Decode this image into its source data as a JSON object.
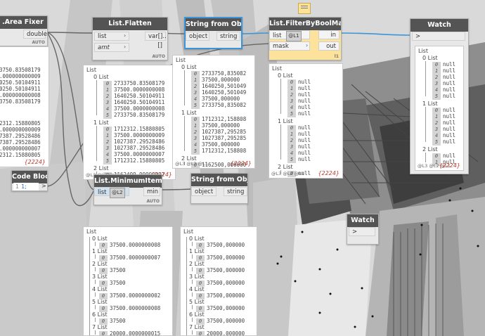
{
  "nodes": {
    "area_fixer": {
      "title": ".Area Fixer",
      "output": "double",
      "lacing": "AUTO"
    },
    "flatten": {
      "title": "List.Flatten",
      "inputs": [
        "list",
        "amt"
      ],
      "output": "var[]..[]",
      "lacing": "AUTO"
    },
    "string_obj_1": {
      "title": "String from Object",
      "input": "object",
      "output": "string"
    },
    "filter": {
      "title": "List.FilterByBoolMask",
      "inputs": [
        "list",
        "mask"
      ],
      "outputs": [
        "in",
        "out"
      ],
      "lacing": "l1",
      "level_selector": "@L1"
    },
    "watch_1": {
      "title": "Watch",
      "input": ">"
    },
    "code_block": {
      "title": "Code Block",
      "line_no": "1",
      "code": "1;",
      "output": ">"
    },
    "minimum": {
      "title": "List.MinimumItem",
      "input": "list",
      "output": "min",
      "lacing": "AUTO",
      "level_selector": "@L2"
    },
    "string_obj_2": {
      "title": "String from Object",
      "input": "object",
      "output": "string"
    },
    "watch_2": {
      "title": "Watch",
      "input": ">"
    }
  },
  "previews": {
    "area_fixer": {
      "rows": [
        "3750.83508179",
        ".000000000009",
        "0250.50104911",
        "0250.50104911",
        ".000000000008",
        "3750.83508179",
        "2312.15880805",
        ".000000000009",
        "7387.29528486",
        "7387.29528486",
        ".000000000007",
        "2312.15880805"
      ],
      "count": "{2224}"
    },
    "flatten": {
      "title": "List",
      "sub0": "0 List",
      "sub0_rows": [
        "2733750.83508179",
        "37500.0000000008",
        "1640250.50104911",
        "1640250.50104911",
        "37500.0000000008",
        "2733750.83508179"
      ],
      "sub1": "1 List",
      "sub1_rows": [
        "1712312.15880805",
        "37500.0000000009",
        "1027387.29528486",
        "1027387.29528486",
        "37500.0000000007",
        "1712312.15880805"
      ],
      "sub2": "2 List",
      "sub2_rows": [
        "1162499.99999997"
      ],
      "levels": "@L3 @L2 @L1",
      "count": "{2224}"
    },
    "string_obj_1": {
      "title": "List",
      "sub0": "0 List",
      "sub0_rows": [
        "2733750,835082",
        "37500,000000",
        "1640250,501049",
        "1640250,501049",
        "37500,000000",
        "2733750,835082"
      ],
      "sub1": "1 List",
      "sub1_rows": [
        "1712312,158808",
        "37500,000000",
        "1027387,295285",
        "1027387,295285",
        "37500,000000",
        "1712312,158808"
      ],
      "sub2": "2 List",
      "sub2_rows": [
        "1162500,000000"
      ],
      "levels": "@L3 @L2 @L1",
      "count": "{2224}"
    },
    "filter": {
      "title": "List",
      "sub0": "0 List",
      "sub0_rows": [
        "null",
        "null",
        "null",
        "null",
        "null",
        "null"
      ],
      "sub1": "1 List",
      "sub1_rows": [
        "null",
        "null",
        "null",
        "null",
        "null",
        "null"
      ],
      "sub2": "2 List",
      "sub2_rows": [
        "null"
      ],
      "levels": "@L3 @L2 @L1",
      "count": "{2224}"
    },
    "watch_1": {
      "title": "List",
      "sub0": "0 List",
      "sub0_rows": [
        "null",
        "null",
        "null",
        "null",
        "null",
        "null"
      ],
      "sub1": "1 List",
      "sub1_rows": [
        "null",
        "null",
        "null",
        "null",
        "null",
        "null"
      ],
      "sub2": "2 List",
      "sub2_rows": [
        "null",
        "null"
      ],
      "levels": "@L3 @L2 @L1",
      "count": "{2224}"
    },
    "minimum": {
      "title": "List",
      "items": [
        {
          "label": "0 List",
          "value": "37500.0000000008"
        },
        {
          "label": "1 List",
          "value": "37500.0000000007"
        },
        {
          "label": "2 List",
          "value": "37500"
        },
        {
          "label": "3 List",
          "value": "37500"
        },
        {
          "label": "4 List",
          "value": "37500.0000000002"
        },
        {
          "label": "5 List",
          "value": "37500.0000000008"
        },
        {
          "label": "6 List",
          "value": "37500"
        },
        {
          "label": "7 List",
          "value": "20000.0000000015"
        }
      ]
    },
    "string_obj_2": {
      "title": "List",
      "items": [
        {
          "label": "0 List",
          "value": "37500,000000"
        },
        {
          "label": "1 List",
          "value": "37500,000000"
        },
        {
          "label": "2 List",
          "value": "37500,000000"
        },
        {
          "label": "3 List",
          "value": "37500,000000"
        },
        {
          "label": "4 List",
          "value": "37500,000000"
        },
        {
          "label": "5 List",
          "value": "37500,000000"
        },
        {
          "label": "6 List",
          "value": "37500,000000"
        },
        {
          "label": "7 List",
          "value": "20000,000000"
        }
      ]
    }
  },
  "colors": {
    "node_header": "#545454",
    "selection": "#3c95d6",
    "frozen": "#fde29b",
    "count": "#c0392b"
  }
}
